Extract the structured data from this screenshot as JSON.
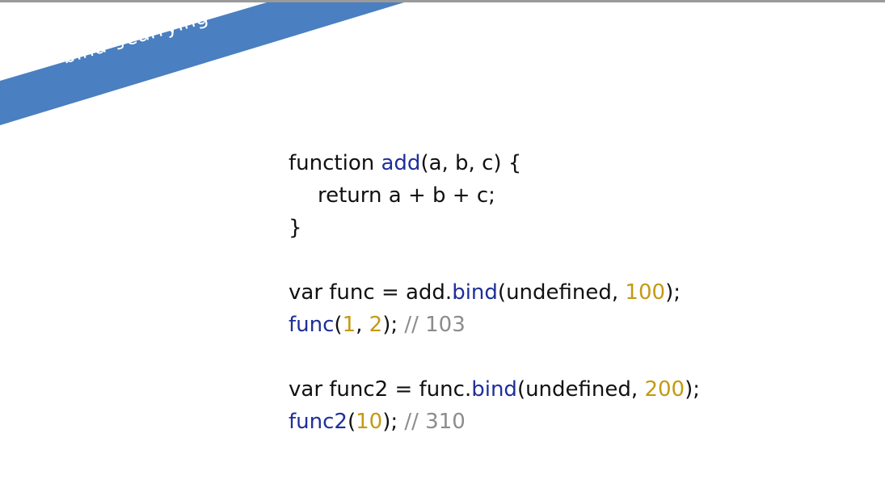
{
  "slide": {
    "title": "bind与currying",
    "colors": {
      "banner": "#4a7fc1",
      "text": "#111111",
      "function_name": "#1f2f9a",
      "number": "#c49a12",
      "comment": "#8c8c8c"
    }
  },
  "code": {
    "l1": {
      "a": "function ",
      "b": "add",
      "c": "(a, b, c) {"
    },
    "l2": {
      "a": "return a + b + c;"
    },
    "l3": {
      "a": "}"
    },
    "l4": {
      "a": "var func = add.",
      "b": "bind",
      "c": "(undefined, ",
      "d": "100",
      "e": ");"
    },
    "l5": {
      "a": "func",
      "b": "(",
      "c": "1",
      "d": ", ",
      "e": "2",
      "f": "); ",
      "g": "// 103"
    },
    "l6": {
      "a": "var func2 = func.",
      "b": "bind",
      "c": "(undefined, ",
      "d": "200",
      "e": ");"
    },
    "l7": {
      "a": "func2",
      "b": "(",
      "c": "10",
      "d": "); ",
      "e": "// 310"
    }
  }
}
